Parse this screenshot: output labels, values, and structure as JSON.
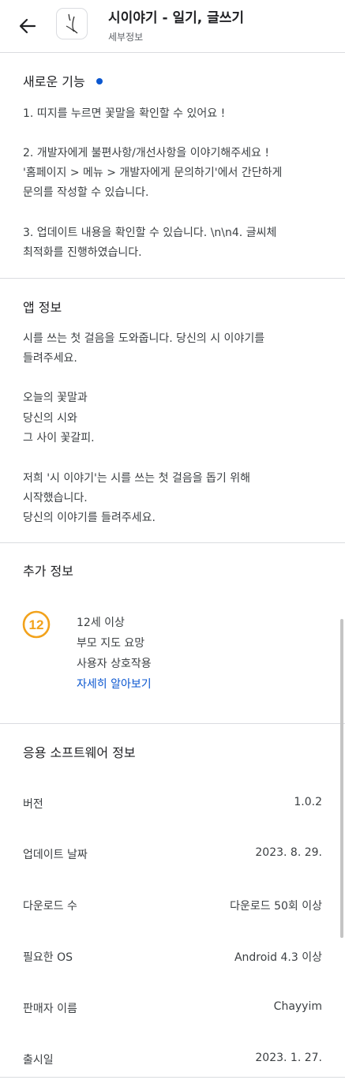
{
  "header": {
    "app_title": "시이야기 - 일기, 글쓰기",
    "subtitle": "세부정보",
    "back_icon": "arrow-back-icon",
    "app_icon": "quill-icon"
  },
  "whats_new": {
    "title": "새로운 기능",
    "lines": [
      "1. 띠지를 누르면 꽃말을 확인할 수 있어요 !",
      "2. 개발자에게 불편사항/개선사항을 이야기해주세요 !",
      "'홈페이지 > 메뉴 > 개발자에게 문의하기'에서 간단하게",
      "문의를 작성할 수 있습니다.",
      "3. 업데이트 내용을 확인할 수 있습니다. \\n\\n4. 글씨체",
      "최적화를 진행하였습니다."
    ]
  },
  "about": {
    "title": "앱 정보",
    "lines": [
      "시를 쓰는 첫 걸음을 도와줍니다. 당신의 시 이야기를",
      "들려주세요.",
      "오늘의 꽃말과",
      "당신의 시와",
      "그 사이 꽃갈피.",
      "저희 '시 이야기'는 시를 쓰는 첫 걸음을 돕기 위해",
      "시작했습니다.",
      "당신의 이야기를 들려주세요."
    ]
  },
  "additional": {
    "title": "추가 정보",
    "rating_badge": "12",
    "rating": "12세 이상",
    "guidance": "부모 지도 요망",
    "interaction": "사용자 상호작용",
    "learn_more": "자세히 알아보기"
  },
  "software": {
    "title": "응용 소프트웨어 정보",
    "rows": [
      {
        "label": "버전",
        "value": "1.0.2"
      },
      {
        "label": "업데이트 날짜",
        "value": "2023. 8. 29."
      },
      {
        "label": "다운로드 수",
        "value": "다운로드 50회 이상"
      },
      {
        "label": "필요한 OS",
        "value": "Android 4.3 이상"
      },
      {
        "label": "판매자 이름",
        "value": "Chayyim"
      },
      {
        "label": "출시일",
        "value": "2023. 1. 27."
      }
    ]
  },
  "colors": {
    "accent": "#0b57d0",
    "rating_badge": "#f2a21b",
    "divider": "#dadce0"
  }
}
